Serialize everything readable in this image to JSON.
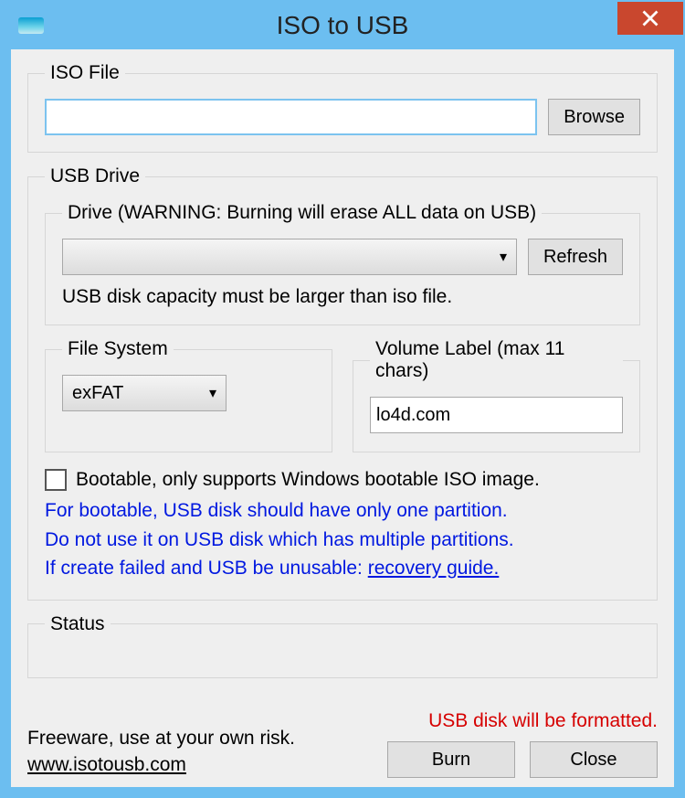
{
  "window": {
    "title": "ISO to USB",
    "close_tooltip": "Close"
  },
  "iso": {
    "legend": "ISO File",
    "path": "",
    "browse_label": "Browse"
  },
  "usb": {
    "legend": "USB Drive",
    "drive": {
      "legend": "Drive (WARNING: Burning will erase ALL data on USB)",
      "selected": "",
      "refresh_label": "Refresh",
      "capacity_note": "USB disk capacity must be larger than iso file."
    },
    "fs": {
      "legend": "File System",
      "selected": "exFAT"
    },
    "vol": {
      "legend": "Volume Label (max 11 chars)",
      "value": "lo4d.com"
    },
    "bootable_label": "Bootable, only supports Windows bootable ISO image.",
    "blue_line1": "For bootable, USB disk should have only one partition.",
    "blue_line2": "Do not use it on USB disk which has multiple partitions.",
    "blue_line3a": "If create failed and USB be unusable: ",
    "blue_line3_link": "recovery guide."
  },
  "status": {
    "legend": "Status",
    "text": ""
  },
  "footer": {
    "freeware": "Freeware, use at your own risk.",
    "site": "www.isotousb.com",
    "warning": "USB disk will be formatted.",
    "burn_label": "Burn",
    "close_label": "Close"
  }
}
